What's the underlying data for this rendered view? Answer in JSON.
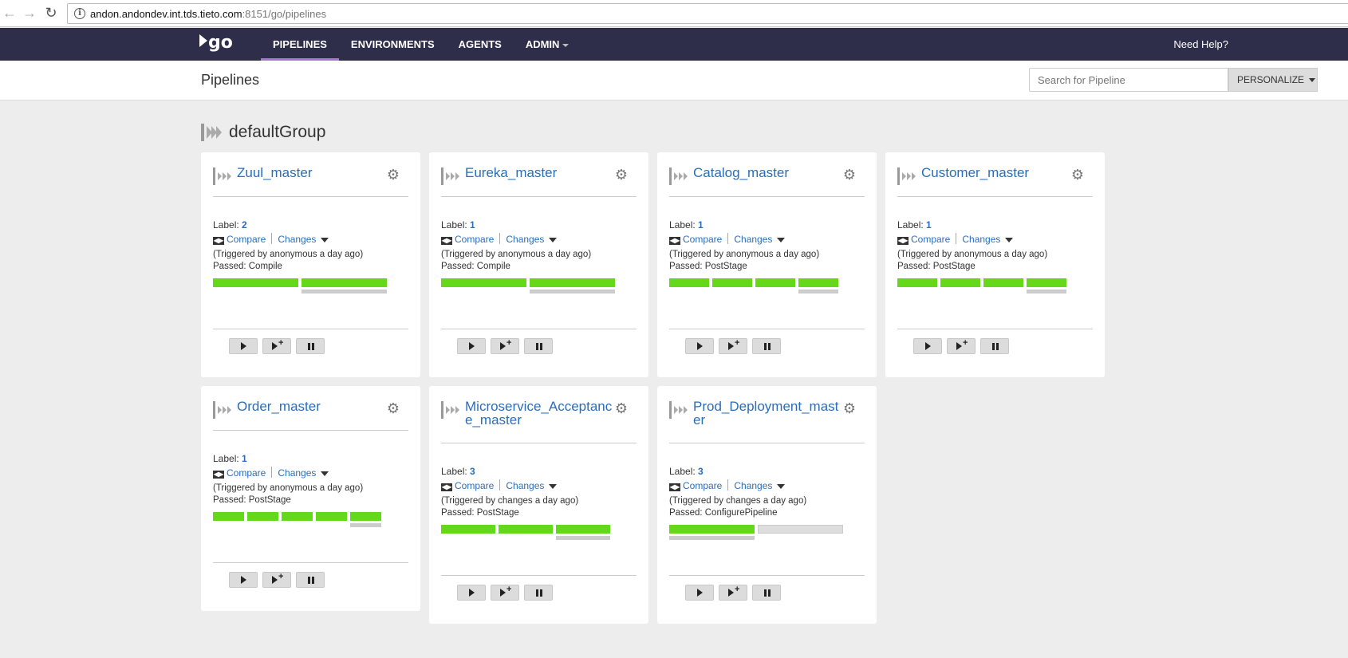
{
  "browser": {
    "url_host": "andon.andondev.int.tds.tieto.com",
    "url_rest": ":8151/go/pipelines"
  },
  "header": {
    "logo": "go",
    "nav": [
      {
        "label": "PIPELINES",
        "active": true
      },
      {
        "label": "ENVIRONMENTS",
        "active": false
      },
      {
        "label": "AGENTS",
        "active": false
      },
      {
        "label": "ADMIN",
        "active": false
      }
    ],
    "help": "Need Help?"
  },
  "subheader": {
    "title": "Pipelines",
    "search_placeholder": "Search for Pipeline",
    "personalize": "PERSONALIZE"
  },
  "group": {
    "name": "defaultGroup"
  },
  "colors": {
    "passed": "#65d819",
    "link": "#2a6ebb",
    "header_bg": "#2f2e4a",
    "active_tab": "#a374d1"
  },
  "pipelines": [
    {
      "name": "Zuul_master",
      "label_prefix": "Label: ",
      "label": "2",
      "compare": "Compare",
      "changes": "Changes",
      "triggered": "(Triggered by anonymous a day ago)",
      "passed": "Passed: Compile",
      "stages": [
        "passed",
        "passed"
      ]
    },
    {
      "name": "Eureka_master",
      "label_prefix": "Label: ",
      "label": "1",
      "compare": "Compare",
      "changes": "Changes",
      "triggered": "(Triggered by anonymous a day ago)",
      "passed": "Passed: Compile",
      "stages": [
        "passed",
        "passed"
      ]
    },
    {
      "name": "Catalog_master",
      "label_prefix": "Label: ",
      "label": "1",
      "compare": "Compare",
      "changes": "Changes",
      "triggered": "(Triggered by anonymous a day ago)",
      "passed": "Passed: PostStage",
      "stages": [
        "passed",
        "passed",
        "passed",
        "passed"
      ]
    },
    {
      "name": "Customer_master",
      "label_prefix": "Label: ",
      "label": "1",
      "compare": "Compare",
      "changes": "Changes",
      "triggered": "(Triggered by anonymous a day ago)",
      "passed": "Passed: PostStage",
      "stages": [
        "passed",
        "passed",
        "passed",
        "passed"
      ]
    },
    {
      "name": "Order_master",
      "label_prefix": "Label: ",
      "label": "1",
      "compare": "Compare",
      "changes": "Changes",
      "triggered": "(Triggered by anonymous a day ago)",
      "passed": "Passed: PostStage",
      "stages": [
        "passed",
        "passed",
        "passed",
        "passed",
        "passed"
      ]
    },
    {
      "name": "Microservice_Acceptance_master",
      "label_prefix": "Label: ",
      "label": "3",
      "compare": "Compare",
      "changes": "Changes",
      "triggered": "(Triggered by changes a day ago)",
      "passed": "Passed: PostStage",
      "stages": [
        "passed",
        "passed",
        "passed"
      ]
    },
    {
      "name": "Prod_Deployment_master",
      "label_prefix": "Label: ",
      "label": "3",
      "compare": "Compare",
      "changes": "Changes",
      "triggered": "(Triggered by changes a day ago)",
      "passed": "Passed: ConfigurePipeline",
      "stages": [
        "passed",
        "not-run"
      ]
    }
  ]
}
